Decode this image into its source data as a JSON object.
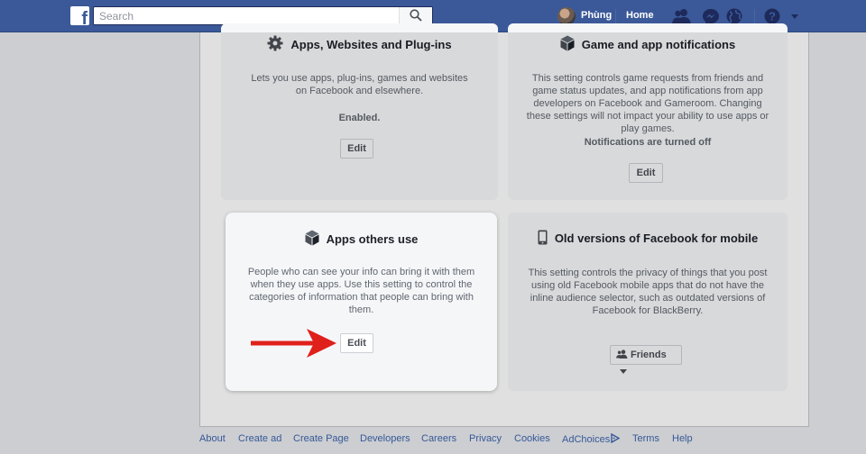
{
  "topbar": {
    "search_placeholder": "Search",
    "user_name": "Phùng",
    "home_label": "Home",
    "icons": [
      "friend-requests-icon",
      "messenger-icon",
      "notifications-globe-icon",
      "help-icon",
      "dropdown-caret-icon"
    ]
  },
  "cards": {
    "apps": {
      "title": "Apps, Websites and Plug-ins",
      "desc": "Lets you use apps, plug-ins, games and websites on Facebook and elsewhere.",
      "status": "Enabled.",
      "button": "Edit"
    },
    "games": {
      "title": "Game and app notifications",
      "desc": "This setting controls game requests from friends and game status updates, and app notifications from app developers on Facebook and Gameroom. Changing these settings will not impact your ability to use apps or play games.",
      "status": "Notifications are turned off",
      "button": "Edit"
    },
    "others": {
      "title": "Apps others use",
      "desc": "People who can see your info can bring it with them when they use apps. Use this setting to control the categories of information that people can bring with them.",
      "button": "Edit"
    },
    "old_versions": {
      "title": "Old versions of Facebook for mobile",
      "desc": "This setting controls the privacy of things that you post using old Facebook mobile apps that do not have the inline audience selector, such as outdated versions of Facebook for BlackBerry.",
      "audience": "Friends"
    }
  },
  "footer": {
    "links": [
      "About",
      "Create ad",
      "Create Page",
      "Developers",
      "Careers",
      "Privacy",
      "Cookies",
      "AdChoices",
      "Terms",
      "Help"
    ]
  },
  "colors": {
    "brand": "#3b5998",
    "arrow": "#e0201b",
    "link": "#365899"
  }
}
